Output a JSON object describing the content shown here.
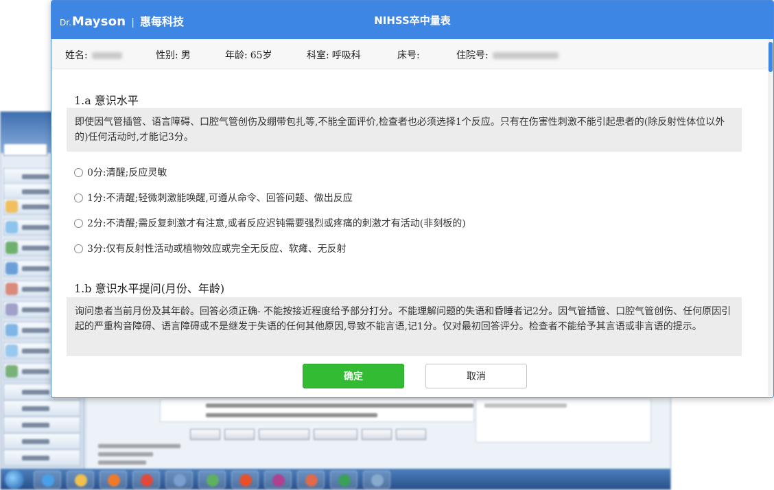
{
  "header": {
    "logo_prefix": "Dr.",
    "logo_brand": "Mayson",
    "logo_separator": "|",
    "company": "惠每科技",
    "title": "NIHSS卒中量表"
  },
  "patient": {
    "name_label": "姓名:",
    "gender_label": "性别:",
    "gender_value": "男",
    "age_label": "年龄:",
    "age_value": "65岁",
    "dept_label": "科室:",
    "dept_value": "呼吸科",
    "bed_label": "床号:",
    "admission_label": "住院号:"
  },
  "sections": [
    {
      "title": "1.a 意识水平",
      "description": "即使因气管插管、语言障碍、口腔气管创伤及绷带包扎等,不能全面评价,检查者也必须选择1个反应。只有在伤害性刺激不能引起患者的(除反射性体位以外的)任何活动时,才能记3分。",
      "options": [
        "0分:清醒;反应灵敏",
        "1分:不清醒;轻微刺激能唤醒,可遵从命令、回答问题、做出反应",
        "2分:不清醒;需反复刺激才有注意,或者反应迟钝需要强烈或疼痛的刺激才有活动(非刻板的)",
        "3分:仅有反射性活动或植物效应或完全无反应、软瘫、无反射"
      ]
    },
    {
      "title": "1.b 意识水平提问(月份、年龄)",
      "description": "询问患者当前月份及其年龄。回答必须正确- 不能按接近程度给予部分打分。不能理解问题的失语和昏睡者记2分。因气管插管、口腔气管创伤、任何原因引起的严重构音障碍、语言障碍或不是继发于失语的任何其他原因,导致不能言语,记1分。仅对最初回答评分。检查者不能给予其言语或非言语的提示。"
    }
  ],
  "buttons": {
    "confirm": "确定",
    "cancel": "取消"
  },
  "colors": {
    "header_bg": "#3d86e3",
    "confirm_bg": "#33bb33",
    "desc_bg": "#ececec"
  }
}
